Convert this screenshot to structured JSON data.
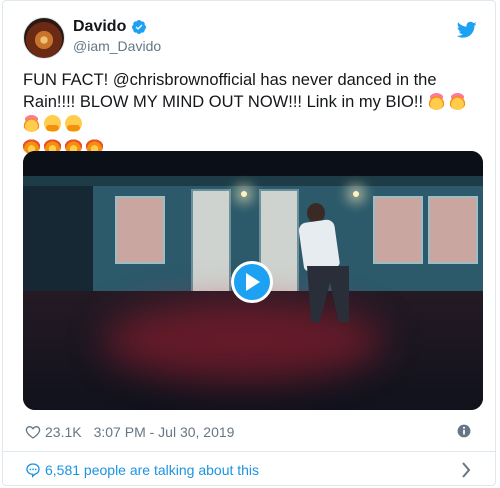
{
  "user": {
    "display_name": "Davido",
    "handle": "@iam_Davido",
    "verified": true
  },
  "tweet": {
    "text": "FUN FACT! @chrisbrownofficial has never danced in the Rain!!!! BLOW MY MIND OUT NOW!!! Link in my BIO!!",
    "emojis_line1": [
      "exploding-head",
      "exploding-head",
      "exploding-head",
      "hugging-face",
      "hugging-face"
    ],
    "emojis_line2": [
      "fire",
      "fire",
      "fire",
      "fire"
    ]
  },
  "media": {
    "type": "video",
    "play_icon": "play-icon"
  },
  "meta": {
    "likes": "23.1K",
    "timestamp": "3:07 PM - Jul 30, 2019"
  },
  "footer": {
    "text": "6,581 people are talking about this"
  },
  "colors": {
    "accent": "#1da1f2",
    "link": "#1b95e0",
    "secondary_text": "#657786",
    "border": "#e1e8ed"
  }
}
